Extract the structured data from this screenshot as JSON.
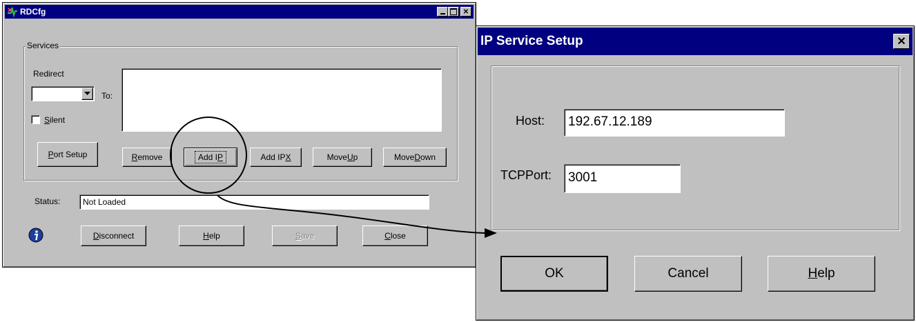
{
  "rdcfg": {
    "title": "RDCfg",
    "services_label": "Services",
    "redirect_label": "Redirect",
    "to_label": "To:",
    "silent_prefix": "",
    "silent_hot": "S",
    "silent_rest": "ilent",
    "buttons": {
      "port_setup_hot": "P",
      "port_setup_rest": "ort Setup",
      "remove_hot": "R",
      "remove_rest": "emove",
      "add_ip_pre": "Add I",
      "add_ip_hot": "P",
      "add_ipx_pre": "Add IP",
      "add_ipx_hot": "X",
      "move_up_pre": "Move ",
      "move_up_hot": "U",
      "move_up_rest": "p",
      "move_down_pre": "Move ",
      "move_down_hot": "D",
      "move_down_rest": "own",
      "disconnect_hot": "D",
      "disconnect_rest": "isconnect",
      "help_hot": "H",
      "help_rest": "elp",
      "save_hot": "S",
      "save_rest": "ave",
      "close_hot": "C",
      "close_rest": "lose"
    },
    "status_label": "Status:",
    "status_value": "Not Loaded"
  },
  "ip_dialog": {
    "title": "IP Service Setup",
    "host_label": "Host:",
    "host_value": "192.67.12.189",
    "port_label": "TCPPort:",
    "port_value": "3001",
    "ok_label": "OK",
    "cancel_label": "Cancel",
    "help_hot": "H",
    "help_rest": "elp"
  },
  "colors": {
    "titlebar": "#000080",
    "face": "#c0c0c0"
  },
  "icons": [
    "app-icon",
    "minimize-icon",
    "maximize-icon",
    "close-icon",
    "dropdown-arrow-icon",
    "info-icon"
  ]
}
